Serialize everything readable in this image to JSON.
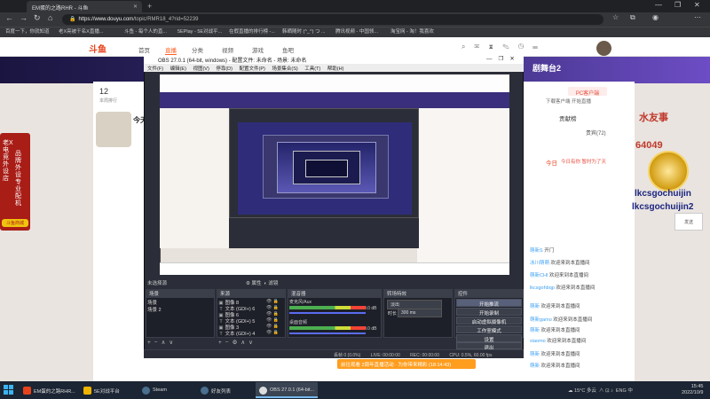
{
  "browser": {
    "tab_title": "EM蛋的之路RHR - 斗鱼",
    "url_host": "https://www.douyu.com",
    "url_path": "/topic/RMR18_4?rid=52239",
    "bookmarks": [
      "百度一下，你就知道",
      "老X亮被干名X直播...",
      "斗鱼 - 每个人的直...",
      "5EPlay - 5E对战平...",
      "在假直播的排行榜 -...",
      "韩晒随时 (^_^) つ ...",
      "腾讯视频 - 中国领...",
      "淘宝网 - 淘！我喜欢"
    ]
  },
  "site": {
    "logo": "斗鱼",
    "nav": [
      "首页",
      "直播",
      "分类",
      "视频",
      "游戏",
      "鱼吧"
    ],
    "stage_title": "剧舞台2",
    "rank_number": "12",
    "rank_label": "本周排行",
    "streamer_name": "今天",
    "pc_button": "PC客户端",
    "right_p1": "下载客户端 开始直播",
    "right_p2": "贡献榜",
    "right_p3": "贵宾(72)",
    "right_p4": "今日",
    "right_p5": "今日有你 暂时为了天",
    "left_ad_col1": "老X电竞外设店",
    "left_ad_col2": "品牌外设专业配机",
    "left_ad_btn": "斗鱼商城",
    "overlay_name": "水友事",
    "overlay_id": "64049",
    "overlay_user1": "lkcsgochuijin",
    "overlay_user2": "lkcsgochuijin2",
    "right_edge_btn": "发送",
    "bottom_banner": "前往观看 2周年直播活动 · 为你带来精彩 (18:14:43)",
    "chat": [
      {
        "user": "萌新S",
        "text": "开门"
      },
      {
        "user": "冰川萌萌",
        "text": "欢迎来到本直播间"
      },
      {
        "user": "萌新CHI",
        "text": "欢迎来到本直播间"
      },
      {
        "user": "lkcsgohbqp",
        "text": "欢迎来到本直播间"
      },
      {
        "user": "萌新",
        "text": "欢迎来到本直播间"
      },
      {
        "user": "萌新gamo",
        "text": "欢迎来到本直播间"
      },
      {
        "user": "萌新",
        "text": "欢迎来到本直播间"
      },
      {
        "user": "xiaomo",
        "text": "欢迎来到本直播间"
      },
      {
        "user": "萌新",
        "text": "欢迎来到本直播间"
      },
      {
        "user": "萌新",
        "text": "欢迎来到本直播间"
      }
    ]
  },
  "obs": {
    "title": "OBS 27.0.1 (64-bit, windows) - 配置文件: 未命名 - 场景: 未命名",
    "menu": [
      "文件(F)",
      "编辑(E)",
      "视图(V)",
      "停靠(D)",
      "配置文件(P)",
      "场景集合(S)",
      "工具(T)",
      "帮助(H)"
    ],
    "no_source": "未选择源",
    "props_btn": "属性",
    "filter_btn": "滤镜",
    "dock_titles": [
      "场景",
      "来源",
      "混音器",
      "转场特效",
      "控件"
    ],
    "scenes": [
      "场景",
      "场景 2"
    ],
    "sources": [
      {
        "icon": "▣",
        "name": "图像 8"
      },
      {
        "icon": "T",
        "name": "文本 (GDI+) 6"
      },
      {
        "icon": "▣",
        "name": "图像 6"
      },
      {
        "icon": "T",
        "name": "文本 (GDI+) 5"
      },
      {
        "icon": "▣",
        "name": "图像 3"
      },
      {
        "icon": "T",
        "name": "文本 (GDI+) 4"
      }
    ],
    "mixer": [
      {
        "label": "麦克风/Aux",
        "db": "0.0 dB"
      },
      {
        "label": "桌面音频",
        "db": "0.0 dB"
      }
    ],
    "transition_type": "淡出",
    "duration_label": "时长",
    "duration_value": "300 ms",
    "controls": [
      "开始推流",
      "开始录制",
      "启动虚拟摄像机",
      "工作室模式",
      "设置",
      "退出"
    ],
    "status": {
      "drop": "丢帧 0 (0.0%)",
      "live": "LIVE: 00:00:00",
      "rec": "REC: 00:00:00",
      "cpu": "CPU: 0.5%, 60.00 fps"
    }
  },
  "taskbar": {
    "tasks": [
      {
        "label": "EM蛋的之路RHR...",
        "color": "#e8431c"
      },
      {
        "label": "5E对战平台",
        "color": "#f0b400"
      },
      {
        "label": "Steam",
        "color": "#1b2838"
      },
      {
        "label": "好友列表",
        "color": "#2a475e"
      },
      {
        "label": "OBS 27.0.1 (64-bit...",
        "color": "#302e31"
      }
    ],
    "weather": "15°C 多云",
    "lang": "ENG",
    "ime": "中",
    "time": "15:45",
    "date": "2022/10/9"
  }
}
